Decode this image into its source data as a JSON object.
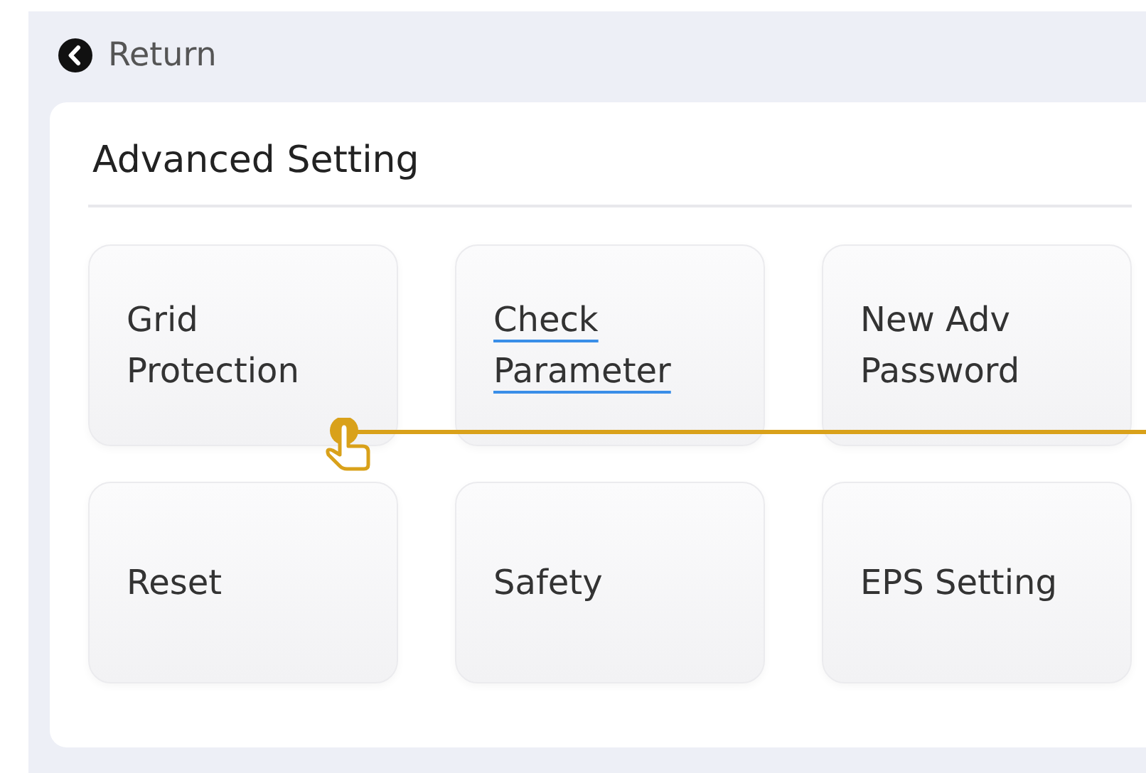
{
  "back": {
    "label": "Return"
  },
  "panel": {
    "title": "Advanced Setting",
    "items": [
      {
        "label": "Grid Protection",
        "underlined": false
      },
      {
        "label": "Check Parameter",
        "underlined": true
      },
      {
        "label": "New Adv Password",
        "underlined": false
      },
      {
        "label": "Reset",
        "underlined": false
      },
      {
        "label": "Safety",
        "underlined": false
      },
      {
        "label": "EPS Setting",
        "underlined": false
      }
    ]
  }
}
